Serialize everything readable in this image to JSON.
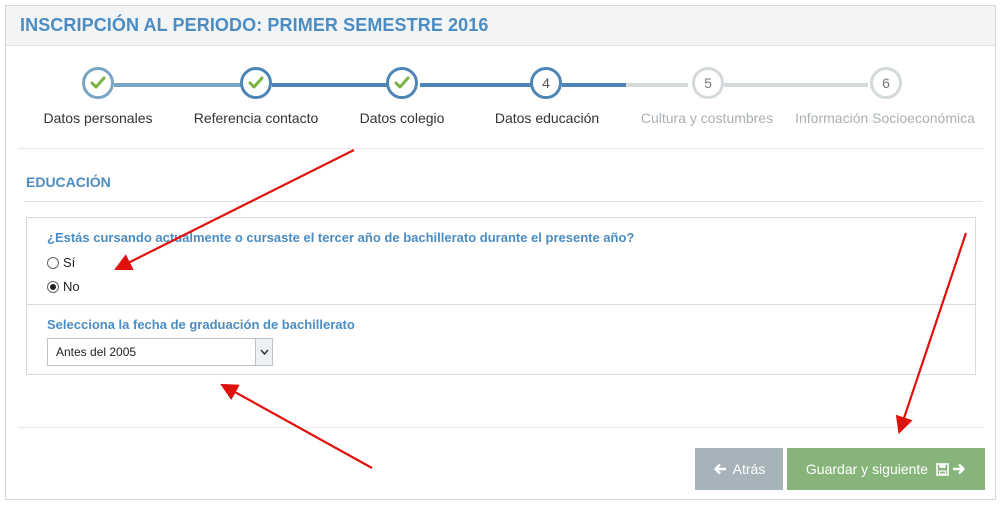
{
  "header": {
    "title": "INSCRIPCIÓN AL PERIODO: PRIMER SEMESTRE 2016"
  },
  "wizard": {
    "steps": [
      {
        "label": "Datos personales",
        "state": "done",
        "number": ""
      },
      {
        "label": "Referencia contacto",
        "state": "done",
        "number": ""
      },
      {
        "label": "Datos colegio",
        "state": "done",
        "number": ""
      },
      {
        "label": "Datos educación",
        "state": "current",
        "number": "4"
      },
      {
        "label": "Cultura y costumbres",
        "state": "pending",
        "number": "5"
      },
      {
        "label": "Información Socioeconómica",
        "state": "pending",
        "number": "6"
      }
    ]
  },
  "section": {
    "title": "EDUCACIÓN"
  },
  "form": {
    "question": "¿Estás cursando actualmente o cursaste el tercer año de bachillerato durante el presente año?",
    "options": [
      {
        "label": "Sí",
        "checked": false
      },
      {
        "label": "No",
        "checked": true
      }
    ],
    "date_label": "Selecciona la fecha de graduación de bachillerato",
    "date_selected": "Antes del 2005"
  },
  "buttons": {
    "back": "Atrás",
    "next": "Guardar y siguiente"
  },
  "colors": {
    "accent": "#4b8cc2",
    "done_check": "#7bb241",
    "pending": "#c9cfd3",
    "back_button": "#a6b3bb",
    "next_button": "#86b47b",
    "annotation_arrow": "#e0100c"
  },
  "icons": {
    "step_done": "check-icon",
    "back": "arrow-left-icon",
    "save": "floppy-disk-icon",
    "next": "arrow-right-icon",
    "select": "chevron-down-icon"
  }
}
